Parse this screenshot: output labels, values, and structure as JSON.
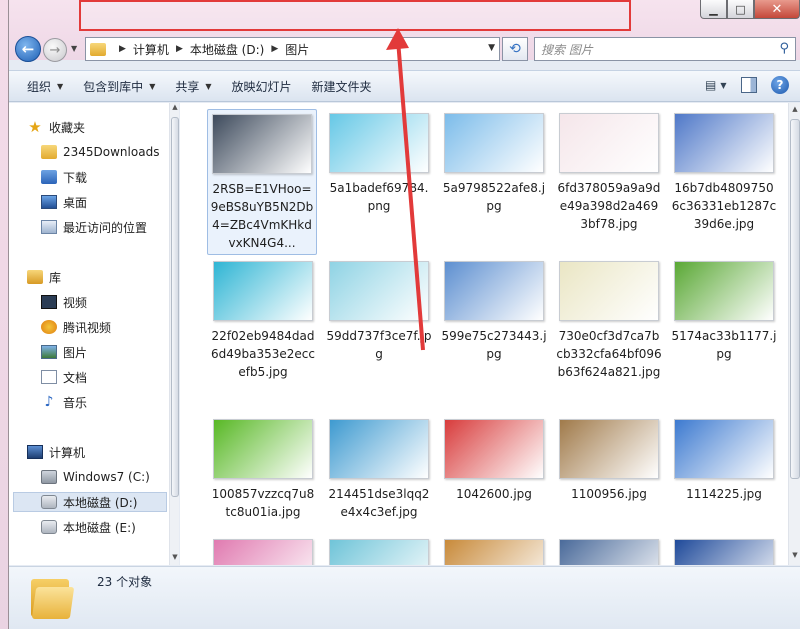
{
  "window": {
    "controls": {
      "minimize": "▁",
      "maximize": "□",
      "close": "✕"
    }
  },
  "nav": {
    "breadcrumb": [
      "计算机",
      "本地磁盘 (D:)",
      "图片"
    ],
    "search_placeholder": "搜索 图片"
  },
  "toolbar": {
    "items": [
      {
        "label": "组织",
        "dropdown": true
      },
      {
        "label": "包含到库中",
        "dropdown": true
      },
      {
        "label": "共享",
        "dropdown": true
      },
      {
        "label": "放映幻灯片",
        "dropdown": false
      },
      {
        "label": "新建文件夹",
        "dropdown": false
      }
    ]
  },
  "sidebar": {
    "items": [
      {
        "label": "收藏夹",
        "icon": "star-icon"
      },
      {
        "label": "2345Downloads",
        "icon": "folder-icon"
      },
      {
        "label": "下载",
        "icon": "download-folder-icon"
      },
      {
        "label": "桌面",
        "icon": "desktop-icon"
      },
      {
        "label": "最近访问的位置",
        "icon": "recent-places-icon"
      },
      {
        "label": "库",
        "icon": "library-icon"
      },
      {
        "label": "视频",
        "icon": "video-icon"
      },
      {
        "label": "腾讯视频",
        "icon": "tencent-video-icon"
      },
      {
        "label": "图片",
        "icon": "pictures-icon"
      },
      {
        "label": "文档",
        "icon": "documents-icon"
      },
      {
        "label": "音乐",
        "icon": "music-icon"
      },
      {
        "label": "计算机",
        "icon": "computer-icon"
      },
      {
        "label": "Windows7 (C:)",
        "icon": "drive-c-icon"
      },
      {
        "label": "本地磁盘 (D:)",
        "icon": "drive-d-icon"
      },
      {
        "label": "本地磁盘 (E:)",
        "icon": "drive-e-icon"
      }
    ]
  },
  "files": [
    {
      "name": "2RSB=E1VHoo=9eBS8uYB5N2Db4=ZBc4VmKHkdvxKN4G4...",
      "thumb": "#3d4a5c"
    },
    {
      "name": "5a1badef69784.png",
      "thumb": "#66c8e6"
    },
    {
      "name": "5a9798522afe8.jpg",
      "thumb": "#7cbcea"
    },
    {
      "name": "6fd378059a9a9de49a398d2a4693bf78.jpg",
      "thumb": "#f5e6ea"
    },
    {
      "name": "16b7db48097506c36331eb1287c39d6e.jpg",
      "thumb": "#4f78c8"
    },
    {
      "name": "22f02eb9484dad6d49ba353e2eccefb5.jpg",
      "thumb": "#2fb5d4"
    },
    {
      "name": "59dd737f3ce7f.jpg",
      "thumb": "#8fd3e4"
    },
    {
      "name": "599e75c273443.jpg",
      "thumb": "#5d8fd0"
    },
    {
      "name": "730e0cf3d7ca7bcb332cfa64bf096b63f624a821.jpg",
      "thumb": "#eae6c4"
    },
    {
      "name": "5174ac33b1177.jpg",
      "thumb": "#5aa835"
    },
    {
      "name": "100857vzzcq7u8tc8u01ia.jpg",
      "thumb": "#58b825"
    },
    {
      "name": "214451dse3lqq2e4x4c3ef.jpg",
      "thumb": "#3e9ad0"
    },
    {
      "name": "1042600.jpg",
      "thumb": "#d83c3c"
    },
    {
      "name": "1100956.jpg",
      "thumb": "#a07a4a"
    },
    {
      "name": "1114225.jpg",
      "thumb": "#3d7ad0"
    },
    {
      "name": "",
      "thumb": "#e07ab0"
    },
    {
      "name": "",
      "thumb": "#6fc4d8"
    },
    {
      "name": "",
      "thumb": "#c88a3a"
    },
    {
      "name": "",
      "thumb": "#4a6a9a"
    },
    {
      "name": "",
      "thumb": "#1f4a9a"
    }
  ],
  "status": {
    "count_text": "23 个对象"
  },
  "colors": {
    "highlight": "#e23a3a",
    "arrow": "#e23a3a"
  }
}
